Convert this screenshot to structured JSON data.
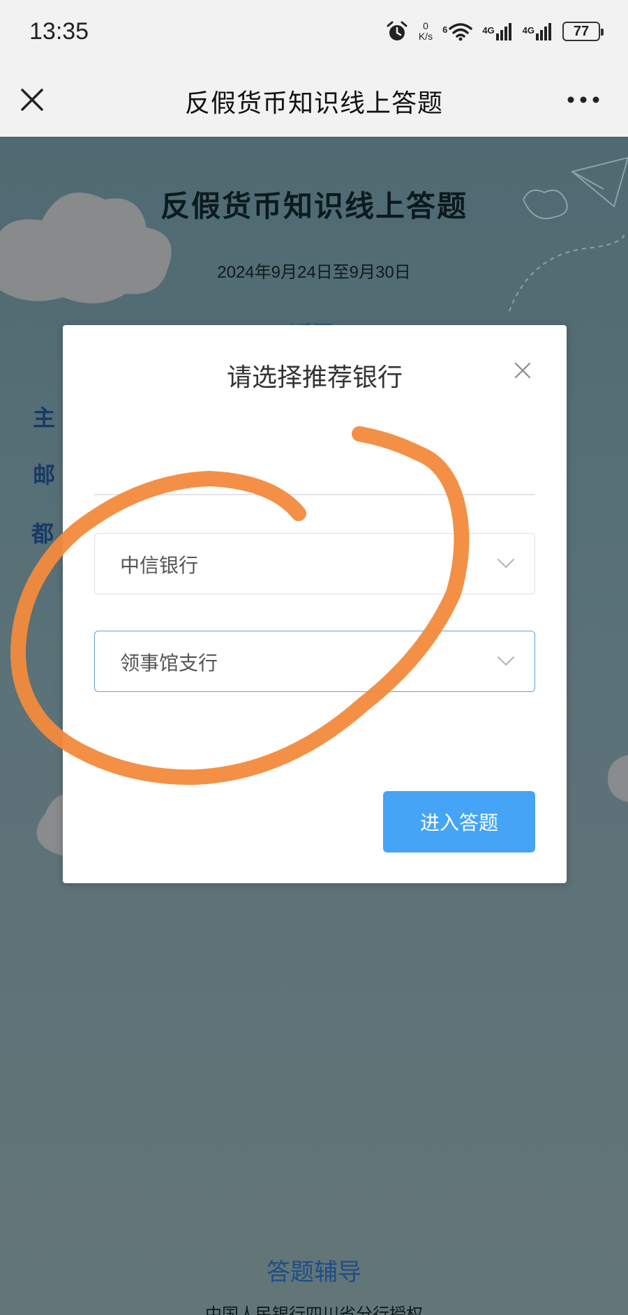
{
  "status_bar": {
    "time": "13:35",
    "net_speed_value": "0",
    "net_speed_unit": "K/s",
    "wifi_label": "6",
    "signal1_label": "4G",
    "signal2_label": "4G",
    "battery": "77"
  },
  "nav": {
    "title": "反假货币知识线上答题"
  },
  "page": {
    "title": "反假货币知识线上答题",
    "date": "2024年9月24日至9月30日",
    "peek_back": "返回",
    "peek_row1": "主",
    "peek_row2": "邮",
    "peek_row3": "都",
    "help_link": "答题辅导",
    "footer": "中国人民银行四川省分行授权"
  },
  "dialog": {
    "title": "请选择推荐银行",
    "bank_select": {
      "value": "中信银行"
    },
    "branch_select": {
      "value": "领事馆支行"
    },
    "enter_button": "进入答题"
  },
  "colors": {
    "accent": "#45a4f6",
    "focus_border": "#5aa3dd",
    "annotation": "#f28a3c"
  }
}
